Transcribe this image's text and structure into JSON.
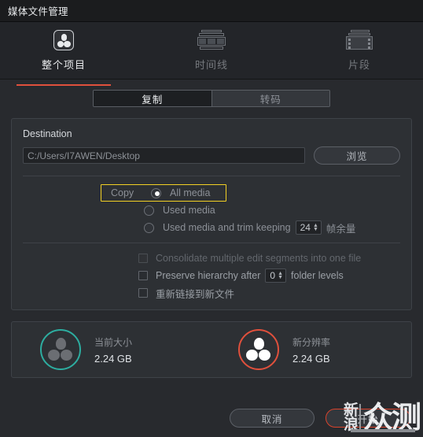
{
  "window": {
    "title": "媒体文件管理"
  },
  "tabs": [
    {
      "label": "整个项目",
      "icon": "project-icon",
      "active": true
    },
    {
      "label": "时间线",
      "icon": "timeline-icon",
      "active": false
    },
    {
      "label": "片段",
      "icon": "clip-icon",
      "active": false
    }
  ],
  "mode_toggle": {
    "copy_label": "复制",
    "transcode_label": "转码",
    "selected": "复制"
  },
  "destination": {
    "label": "Destination",
    "path_value": "C:/Users/I7AWEN/Desktop",
    "path_placeholder": "C:/Users/I7AWEN/Desktop",
    "browse_label": "浏览"
  },
  "copy_options": {
    "prefix_label": "Copy",
    "radios": [
      {
        "label": "All media",
        "checked": true
      },
      {
        "label": "Used media",
        "checked": false
      },
      {
        "label": "Used media and trim keeping",
        "checked": false
      }
    ],
    "handles_value": "24",
    "handles_suffix": "帧余量",
    "highlight_color": "#f2d024"
  },
  "checkboxes": [
    {
      "label": "Consolidate multiple edit segments into one file",
      "checked": false,
      "disabled": true
    },
    {
      "label": "Preserve hierarchy after",
      "checked": false,
      "disabled": false,
      "spinner": "0",
      "suffix": "folder levels"
    },
    {
      "label": "重新链接到新文件",
      "checked": false,
      "disabled": false
    }
  ],
  "stats": [
    {
      "title": "当前大小",
      "value": "2.24 GB",
      "ring_color": "#2dada0"
    },
    {
      "title": "新分辨率",
      "value": "2.24 GB",
      "ring_color": "#e0503c"
    }
  ],
  "footer": {
    "cancel_label": "取消",
    "start_label": "开始"
  },
  "watermark": {
    "line1": "新",
    "line2": "浪",
    "text": "众测"
  }
}
